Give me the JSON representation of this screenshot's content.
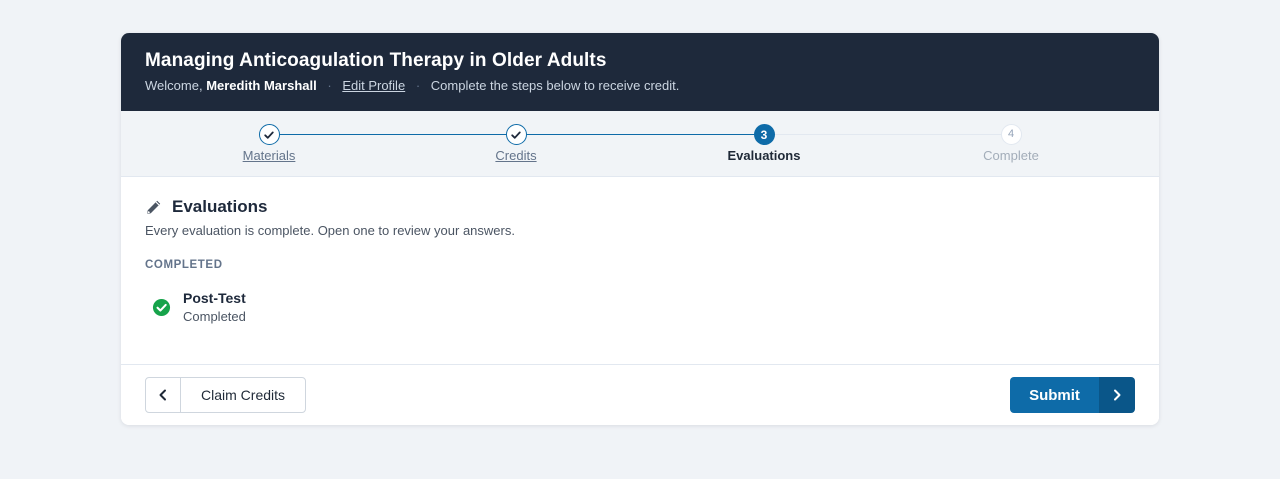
{
  "header": {
    "title": "Managing Anticoagulation Therapy in Older Adults",
    "welcome_prefix": "Welcome,",
    "user_name": "Meredith Marshall",
    "edit_profile_label": "Edit Profile",
    "separator": "·",
    "instructions": "Complete the steps below to receive credit."
  },
  "stepper": {
    "steps": [
      {
        "number": "1",
        "label": "Materials",
        "state": "done"
      },
      {
        "number": "2",
        "label": "Credits",
        "state": "done"
      },
      {
        "number": "3",
        "label": "Evaluations",
        "state": "active"
      },
      {
        "number": "4",
        "label": "Complete",
        "state": "todo"
      }
    ]
  },
  "section": {
    "title": "Evaluations",
    "description": "Every evaluation is complete. Open one to review your answers.",
    "group_label": "COMPLETED",
    "items": [
      {
        "title": "Post-Test",
        "status": "Completed"
      }
    ]
  },
  "footer": {
    "back_label": "Claim Credits",
    "submit_label": "Submit"
  },
  "colors": {
    "header_bg": "#1e293b",
    "primary": "#0e6ba8",
    "primary_dark": "#0a5689",
    "success": "#16a34a",
    "page_bg": "#f0f3f7"
  }
}
